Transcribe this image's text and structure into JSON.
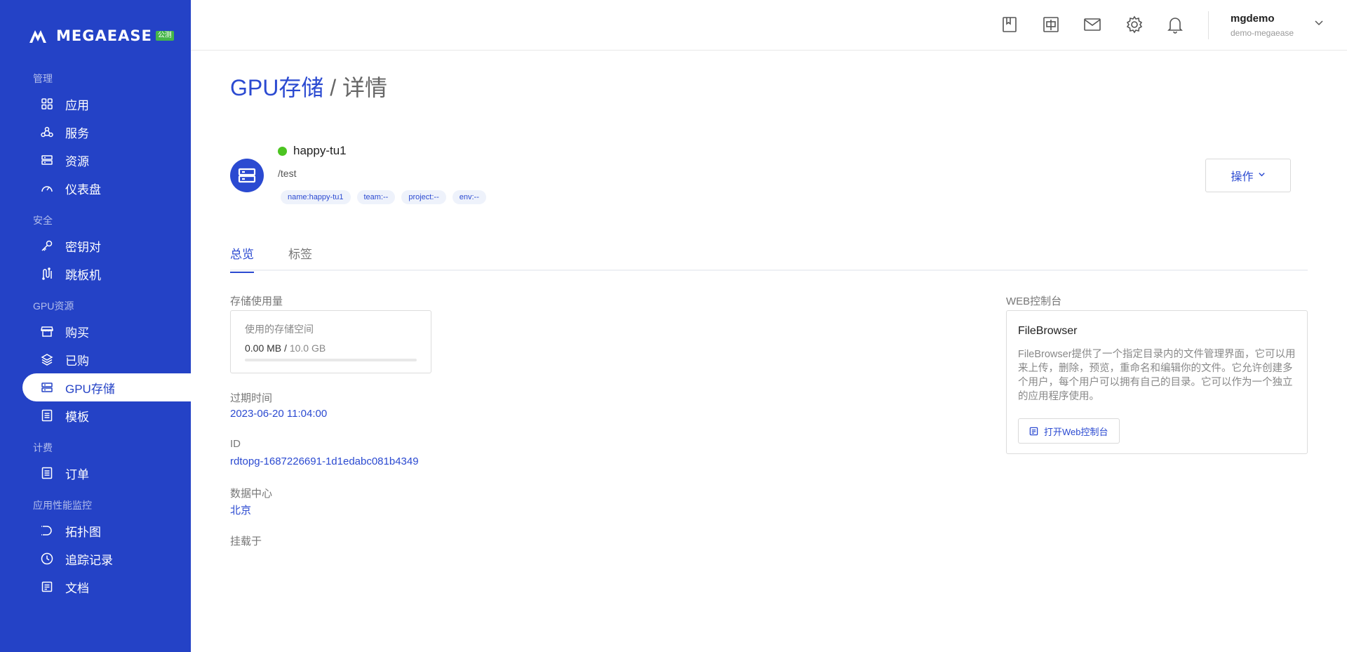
{
  "brand": {
    "name": "MEGAEASE",
    "badge": "公测"
  },
  "sidebar": {
    "sections": [
      {
        "title": "管理",
        "items": [
          {
            "label": "应用",
            "icon": "apps-icon"
          },
          {
            "label": "服务",
            "icon": "services-icon"
          },
          {
            "label": "资源",
            "icon": "server-icon"
          },
          {
            "label": "仪表盘",
            "icon": "dashboard-icon"
          }
        ]
      },
      {
        "title": "安全",
        "items": [
          {
            "label": "密钥对",
            "icon": "key-icon"
          },
          {
            "label": "跳板机",
            "icon": "jump-host-icon"
          }
        ]
      },
      {
        "title": "GPU资源",
        "items": [
          {
            "label": "购买",
            "icon": "shop-icon"
          },
          {
            "label": "已购",
            "icon": "layers-icon"
          },
          {
            "label": "GPU存储",
            "icon": "storage-icon",
            "active": true
          },
          {
            "label": "模板",
            "icon": "template-icon"
          }
        ]
      },
      {
        "title": "计费",
        "items": [
          {
            "label": "订单",
            "icon": "order-icon"
          }
        ]
      },
      {
        "title": "应用性能监控",
        "items": [
          {
            "label": "拓扑图",
            "icon": "topology-icon"
          },
          {
            "label": "追踪记录",
            "icon": "clock-icon"
          },
          {
            "label": "文档",
            "icon": "document-icon"
          }
        ]
      }
    ]
  },
  "topbar": {
    "icons": [
      "bookmark-icon",
      "language-icon",
      "mail-icon",
      "gear-icon",
      "bell-icon"
    ],
    "user": {
      "name": "mgdemo",
      "org": "demo-megaease"
    }
  },
  "page": {
    "title_main": "GPU存储",
    "title_sep": " / ",
    "title_sub": "详情"
  },
  "resource": {
    "status_color": "#4cc421",
    "name": "happy-tu1",
    "path": "/test",
    "tags": [
      "name:happy-tu1",
      "team:--",
      "project:--",
      "env:--"
    ],
    "action_label": "操作"
  },
  "tabs": [
    {
      "label": "总览",
      "active": true
    },
    {
      "label": "标签",
      "active": false
    }
  ],
  "overview": {
    "usage_label": "存储使用量",
    "usage_card_title": "使用的存储空间",
    "used": "0.00 MB",
    "sep": " / ",
    "total": "10.0 GB",
    "used_fraction": 0.0,
    "expire_label": "过期时间",
    "expire_value": "2023-06-20 11:04:00",
    "id_label": "ID",
    "id_value": "rdtopg-1687226691-1d1edabc081b4349",
    "dc_label": "数据中心",
    "dc_value": "北京",
    "mount_label": "挂载于"
  },
  "web_console": {
    "section_label": "WEB控制台",
    "title": "FileBrowser",
    "description": "FileBrowser提供了一个指定目录内的文件管理界面，它可以用来上传，删除，预览，重命名和编辑你的文件。它允许创建多个用户，每个用户可以拥有自己的目录。它可以作为一个独立的应用程序使用。",
    "button_label": "打开Web控制台"
  },
  "colors": {
    "sidebar": "#2442c6",
    "accent": "#2b4ad1",
    "status_green": "#4cc421"
  }
}
